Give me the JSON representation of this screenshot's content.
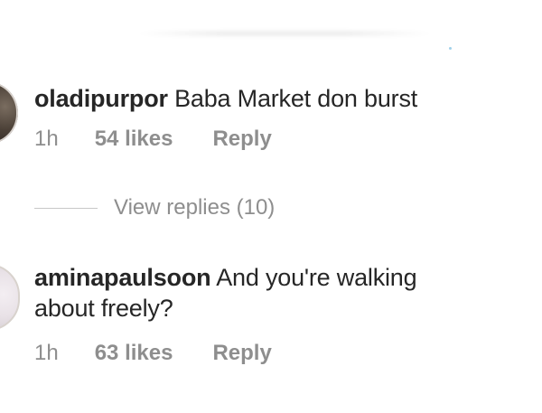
{
  "comments": [
    {
      "username": "oladipurpor",
      "text": " Baba Market don burst",
      "time": "1h",
      "likes": "54 likes",
      "reply": "Reply"
    },
    {
      "username": "aminapaulsoon",
      "text": " And you're walking about freely?",
      "time": "1h",
      "likes": "63 likes",
      "reply": "Reply"
    }
  ],
  "view_replies": {
    "label": "View replies (10)"
  }
}
